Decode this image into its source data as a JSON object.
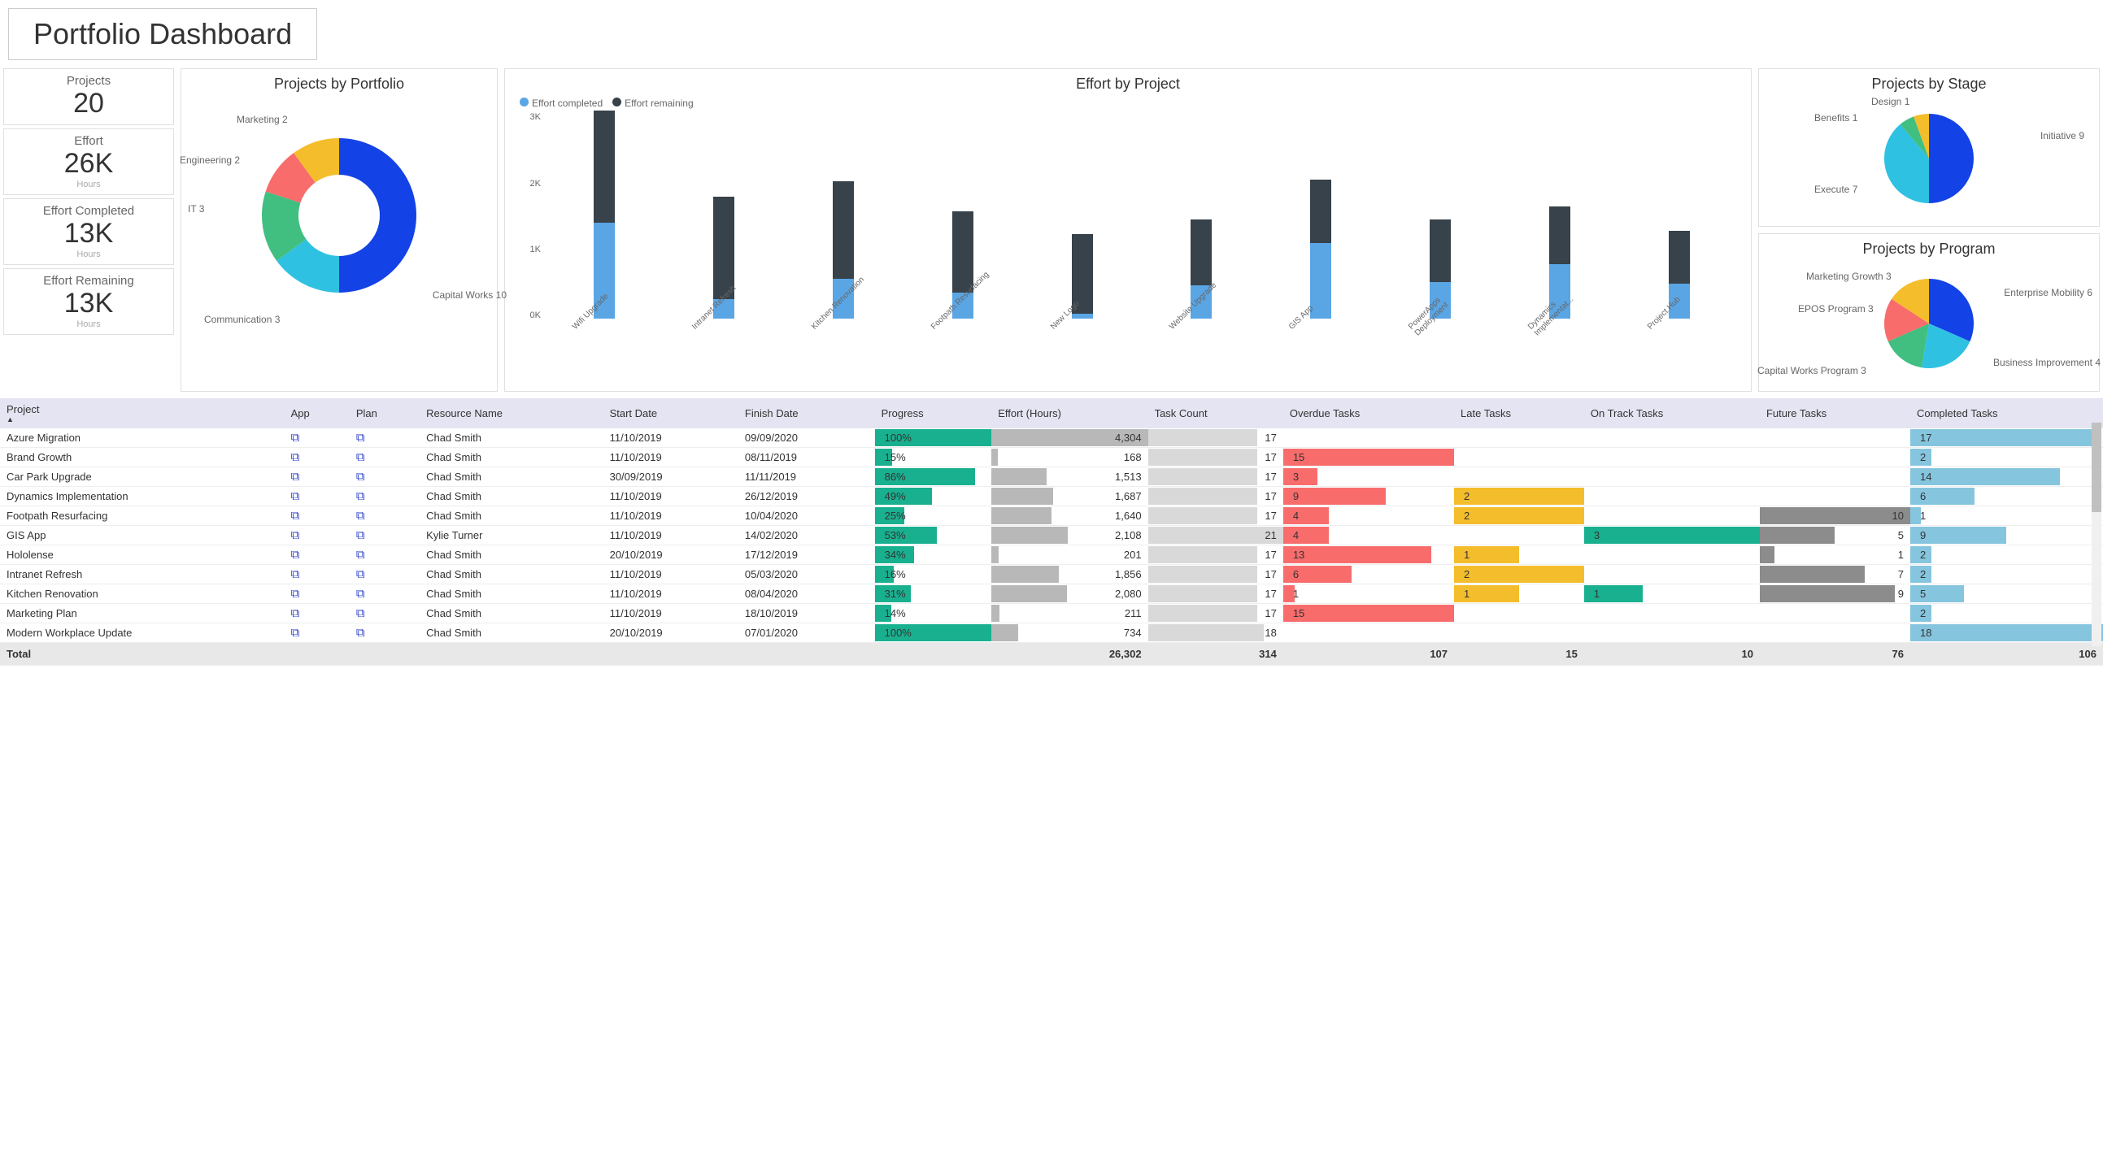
{
  "title": "Portfolio Dashboard",
  "kpis": {
    "projects": {
      "label": "Projects",
      "value": "20"
    },
    "effort": {
      "label": "Effort",
      "value": "26K",
      "sub": "Hours"
    },
    "completed": {
      "label": "Effort Completed",
      "value": "13K",
      "sub": "Hours"
    },
    "remaining": {
      "label": "Effort Remaining",
      "value": "13K",
      "sub": "Hours"
    }
  },
  "colors": {
    "blue": "#1342e6",
    "cyan": "#2fc1e1",
    "green": "#40bf80",
    "red": "#f86c6c",
    "yellow": "#f4bd2c",
    "darkslate": "#37424a",
    "skyblue": "#5aa5e4",
    "teal": "#19b08f",
    "grey": "#b8b8b8",
    "ltblue": "#86c5de"
  },
  "chart_data": [
    {
      "id": "portfolio",
      "type": "pie",
      "title": "Projects by Portfolio",
      "donut": true,
      "categories": [
        "Capital Works",
        "Communication",
        "IT",
        "Engineering",
        "Marketing"
      ],
      "values": [
        10,
        3,
        3,
        2,
        2
      ],
      "labels": [
        "Capital Works 10",
        "Communication 3",
        "IT 3",
        "Engineering 2",
        "Marketing 2"
      ],
      "colors": [
        "#1342e6",
        "#2fc1e1",
        "#40bf80",
        "#f86c6c",
        "#f4bd2c"
      ]
    },
    {
      "id": "effort",
      "type": "bar",
      "title": "Effort by Project",
      "legend": [
        "Effort completed",
        "Effort remaining"
      ],
      "y_ticks": [
        "0K",
        "1K",
        "2K",
        "3K"
      ],
      "ymax": 3200,
      "categories": [
        "Wifi Upgrade",
        "Intranet Refresh",
        "Kitchen Renovation",
        "Footpath Resurfacing",
        "New Logo",
        "Website Upgrade",
        "GIS App",
        "PowerApps Deployment",
        "Dynamics Implementat...",
        "Project Hub"
      ],
      "series": [
        {
          "name": "Effort completed",
          "color": "#5aa5e4",
          "values": [
            1450,
            300,
            600,
            400,
            80,
            500,
            1150,
            550,
            830,
            530
          ]
        },
        {
          "name": "Effort remaining",
          "color": "#37424a",
          "values": [
            1700,
            1550,
            1480,
            1230,
            1200,
            1000,
            960,
            950,
            870,
            800
          ]
        }
      ]
    },
    {
      "id": "stage",
      "type": "pie",
      "title": "Projects by Stage",
      "categories": [
        "Initiative",
        "Execute",
        "Benefits",
        "Design"
      ],
      "values": [
        9,
        7,
        1,
        1
      ],
      "labels": [
        "Initiative 9",
        "Execute 7",
        "Benefits 1",
        "Design 1"
      ],
      "colors": [
        "#1342e6",
        "#2fc1e1",
        "#40bf80",
        "#f4bd2c"
      ]
    },
    {
      "id": "program",
      "type": "pie",
      "title": "Projects by Program",
      "categories": [
        "Enterprise Mobility",
        "Business Improvement",
        "Capital Works Program",
        "EPOS Program",
        "Marketing Growth"
      ],
      "values": [
        6,
        4,
        3,
        3,
        3
      ],
      "labels": [
        "Enterprise Mobility 6",
        "Business Improvement 4",
        "Capital Works Program 3",
        "EPOS Program 3",
        "Marketing Growth 3"
      ],
      "colors": [
        "#1342e6",
        "#2fc1e1",
        "#40bf80",
        "#f86c6c",
        "#f4bd2c"
      ]
    }
  ],
  "table": {
    "columns": [
      "Project",
      "App",
      "Plan",
      "Resource Name",
      "Start Date",
      "Finish Date",
      "Progress",
      "Effort (Hours)",
      "Task Count",
      "Overdue Tasks",
      "Late Tasks",
      "On Track Tasks",
      "Future Tasks",
      "Completed Tasks"
    ],
    "rows": [
      {
        "project": "Azure Migration",
        "resource": "Chad Smith",
        "start": "11/10/2019",
        "finish": "09/09/2020",
        "progress": 100,
        "effort": "4,304",
        "tasks": 17,
        "overdue": null,
        "late": null,
        "ontrack": null,
        "future": null,
        "completed": 17
      },
      {
        "project": "Brand Growth",
        "resource": "Chad Smith",
        "start": "11/10/2019",
        "finish": "08/11/2019",
        "progress": 15,
        "effort": "168",
        "tasks": 17,
        "overdue": 15,
        "late": null,
        "ontrack": null,
        "future": null,
        "completed": 2
      },
      {
        "project": "Car Park Upgrade",
        "resource": "Chad Smith",
        "start": "30/09/2019",
        "finish": "11/11/2019",
        "progress": 86,
        "effort": "1,513",
        "tasks": 17,
        "overdue": 3,
        "late": null,
        "ontrack": null,
        "future": null,
        "completed": 14
      },
      {
        "project": "Dynamics Implementation",
        "resource": "Chad Smith",
        "start": "11/10/2019",
        "finish": "26/12/2019",
        "progress": 49,
        "effort": "1,687",
        "tasks": 17,
        "overdue": 9,
        "late": 2,
        "ontrack": null,
        "future": null,
        "completed": 6
      },
      {
        "project": "Footpath Resurfacing",
        "resource": "Chad Smith",
        "start": "11/10/2019",
        "finish": "10/04/2020",
        "progress": 25,
        "effort": "1,640",
        "tasks": 17,
        "overdue": 4,
        "late": 2,
        "ontrack": null,
        "future": 10,
        "completed": 1
      },
      {
        "project": "GIS App",
        "resource": "Kylie Turner",
        "start": "11/10/2019",
        "finish": "14/02/2020",
        "progress": 53,
        "effort": "2,108",
        "tasks": 21,
        "overdue": 4,
        "late": null,
        "ontrack": 3,
        "future": 5,
        "completed": 9
      },
      {
        "project": "Hololense",
        "resource": "Chad Smith",
        "start": "20/10/2019",
        "finish": "17/12/2019",
        "progress": 34,
        "effort": "201",
        "tasks": 17,
        "overdue": 13,
        "late": 1,
        "ontrack": null,
        "future": 1,
        "completed": 2
      },
      {
        "project": "Intranet Refresh",
        "resource": "Chad Smith",
        "start": "11/10/2019",
        "finish": "05/03/2020",
        "progress": 16,
        "effort": "1,856",
        "tasks": 17,
        "overdue": 6,
        "late": 2,
        "ontrack": null,
        "future": 7,
        "completed": 2
      },
      {
        "project": "Kitchen Renovation",
        "resource": "Chad Smith",
        "start": "11/10/2019",
        "finish": "08/04/2020",
        "progress": 31,
        "effort": "2,080",
        "tasks": 17,
        "overdue": 1,
        "late": 1,
        "ontrack": 1,
        "future": 9,
        "completed": 5
      },
      {
        "project": "Marketing Plan",
        "resource": "Chad Smith",
        "start": "11/10/2019",
        "finish": "18/10/2019",
        "progress": 14,
        "effort": "211",
        "tasks": 17,
        "overdue": 15,
        "late": null,
        "ontrack": null,
        "future": null,
        "completed": 2
      },
      {
        "project": "Modern Workplace Update",
        "resource": "Chad Smith",
        "start": "20/10/2019",
        "finish": "07/01/2020",
        "progress": 100,
        "effort": "734",
        "tasks": 18,
        "overdue": null,
        "late": null,
        "ontrack": null,
        "future": null,
        "completed": 18
      }
    ],
    "totals": {
      "effort": "26,302",
      "tasks": "314",
      "overdue": "107",
      "late": "15",
      "ontrack": "10",
      "future": "76",
      "completed": "106"
    },
    "total_label": "Total",
    "bar_max": {
      "effort": 4304,
      "tasks": 21,
      "overdue": 15,
      "late": 2,
      "ontrack": 3,
      "future": 10,
      "completed": 18
    }
  }
}
